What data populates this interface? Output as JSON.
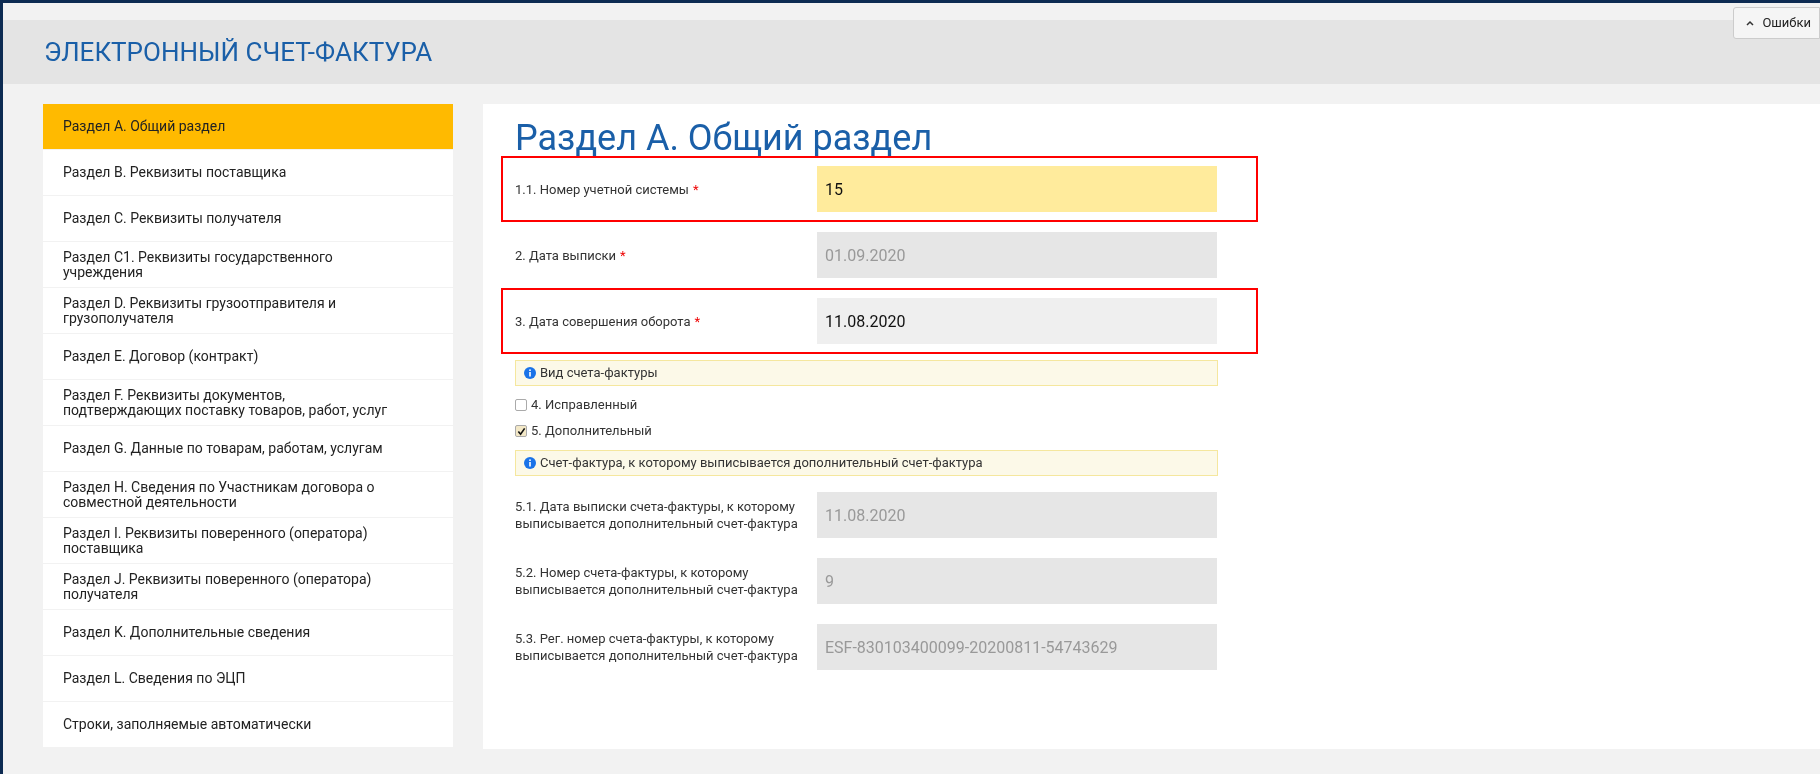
{
  "header": {
    "title": "ЭЛЕКТРОННЫЙ СЧЕТ-ФАКТУРА"
  },
  "errors_button": {
    "label": "Ошибки"
  },
  "sidebar": {
    "items": [
      {
        "label": "Раздел A. Общий раздел",
        "selected": true
      },
      {
        "label": "Раздел B. Реквизиты поставщика",
        "selected": false
      },
      {
        "label": "Раздел C. Реквизиты получателя",
        "selected": false
      },
      {
        "label": "Раздел C1. Реквизиты государственного учреждения",
        "selected": false
      },
      {
        "label": "Раздел D. Реквизиты грузоотправителя и грузополучателя",
        "selected": false
      },
      {
        "label": "Раздел E. Договор (контракт)",
        "selected": false
      },
      {
        "label": "Раздел F. Реквизиты документов, подтверждающих поставку товаров, работ, услуг",
        "selected": false
      },
      {
        "label": "Раздел G. Данные по товарам, работам, услугам",
        "selected": false
      },
      {
        "label": "Раздел H. Сведения по Участникам договора о совместной деятельности",
        "selected": false
      },
      {
        "label": "Раздел I. Реквизиты поверенного (оператора) поставщика",
        "selected": false
      },
      {
        "label": "Раздел J. Реквизиты поверенного (оператора) получателя",
        "selected": false
      },
      {
        "label": "Раздел K. Дополнительные сведения",
        "selected": false
      },
      {
        "label": "Раздел L. Сведения по ЭЦП",
        "selected": false
      },
      {
        "label": "Строки, заполняемые автоматически",
        "selected": false
      }
    ]
  },
  "section": {
    "title": "Раздел A. Общий раздел",
    "items": [
      {
        "kind": "field",
        "label": "1.1. Номер учетной системы",
        "required_mark": "*",
        "value": "15",
        "focused": true,
        "disabled": false,
        "highlighted": true
      },
      {
        "kind": "field",
        "label": "2. Дата выписки",
        "required_mark": "*",
        "value": "01.09.2020",
        "focused": false,
        "disabled": true,
        "highlighted": false
      },
      {
        "kind": "field",
        "label": "3. Дата совершения оборота",
        "required_mark": "*",
        "value": "11.08.2020",
        "focused": false,
        "disabled": false,
        "highlighted": true
      },
      {
        "kind": "info",
        "label": "Вид счета-фактуры"
      },
      {
        "kind": "checkbox",
        "label": "4. Исправленный",
        "checked": false
      },
      {
        "kind": "checkbox",
        "label": "5. Дополнительный",
        "checked": true
      },
      {
        "kind": "info",
        "label": "Счет-фактура, к которому выписывается дополнительный счет-фактура"
      },
      {
        "kind": "field",
        "label": "5.1. Дата выписки счета-фактуры, к которому выписывается дополнительный счет-фактура",
        "value": "11.08.2020",
        "focused": false,
        "disabled": true,
        "highlighted": false
      },
      {
        "kind": "field",
        "label": "5.2. Номер счета-фактуры, к которому выписывается дополнительный счет-фактура",
        "value": "9",
        "focused": false,
        "disabled": true,
        "highlighted": false
      },
      {
        "kind": "field",
        "label": "5.3. Рег. номер счета-фактуры, к которому выписывается дополнительный счет-фактура",
        "value": "ESF-830103400099-20200811-54743629",
        "focused": false,
        "disabled": true,
        "highlighted": false
      }
    ]
  }
}
